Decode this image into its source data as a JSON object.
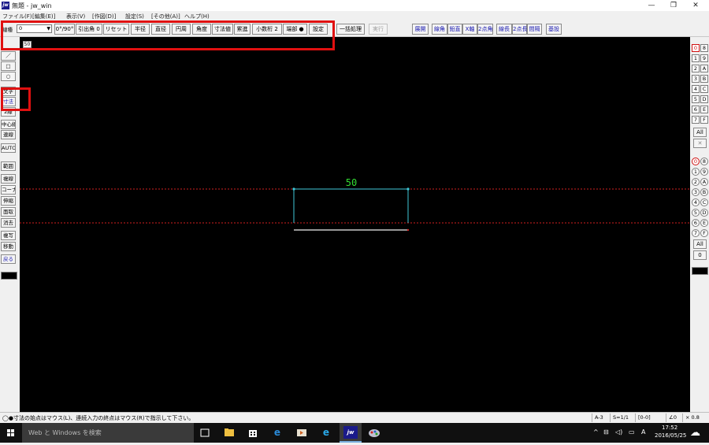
{
  "window": {
    "title": "無題 - jw_win",
    "app_icon_text": "jw",
    "minimize": "—",
    "maximize": "❐",
    "close": "✕"
  },
  "menu": [
    "ファイル(F)",
    "[編集(E)]",
    "表示(V)",
    "[作図(D)]",
    "設定(S)",
    "[その他(A)]",
    "ヘルプ(H)"
  ],
  "toolbar": {
    "linetype_label": "線種",
    "linetype_value": "0",
    "buttons_main": [
      "0°/90°",
      "引出角 0",
      "リセット",
      "半径",
      "直径",
      "円周",
      "角度",
      "寸法値",
      "累進",
      "小数桁 2",
      "端部 ●",
      "設定"
    ],
    "batch": "一括処理",
    "execute": "実行",
    "buttons_right_a": [
      "展開"
    ],
    "buttons_right_b": [
      "線角",
      "鉛直",
      "X軸",
      "2点角"
    ],
    "buttons_right_c": [
      "線長",
      "2点長",
      "間隔"
    ],
    "buttons_right_d": [
      "基設"
    ]
  },
  "canvas": {
    "input_value": "50",
    "dimension_value": "50",
    "colors": {
      "background": "#000000",
      "dimension_text": "#33dd33",
      "extension_line": "#40c8d8",
      "guide_line": "#d02020",
      "base_line": "#c8c8c8"
    }
  },
  "left_tools": [
    "／",
    "□",
    "○",
    "文字",
    "寸法",
    "2線",
    "中心線",
    "連線",
    "AUTO",
    "範囲",
    "複線",
    "コーナー",
    "伸縮",
    "面取",
    "消去",
    "複写",
    "移動",
    "戻る"
  ],
  "right_layers": {
    "group_a": [
      "0",
      "8",
      "1",
      "9",
      "2",
      "A",
      "3",
      "B",
      "4",
      "C",
      "5",
      "D",
      "6",
      "E",
      "7",
      "F"
    ],
    "group_b": [
      "0",
      "8",
      "1",
      "9",
      "2",
      "A",
      "3",
      "B",
      "4",
      "C",
      "5",
      "D",
      "6",
      "E",
      "7",
      "F"
    ],
    "all_label": "All",
    "x_label": "✕",
    "zero_label": "0"
  },
  "status": {
    "message": "◯●寸法の始点はマウス(L)、連続入力の終点はマウス(R)で指示して下さい。",
    "paper": "A-3",
    "scale": "S=1/1",
    "layer": "[0-0]",
    "angle": "∠0",
    "zoom": "× 0.8"
  },
  "taskbar": {
    "search_placeholder": "Web と Windows を検索",
    "time": "17:52",
    "date": "2016/05/25",
    "ime": "A"
  }
}
